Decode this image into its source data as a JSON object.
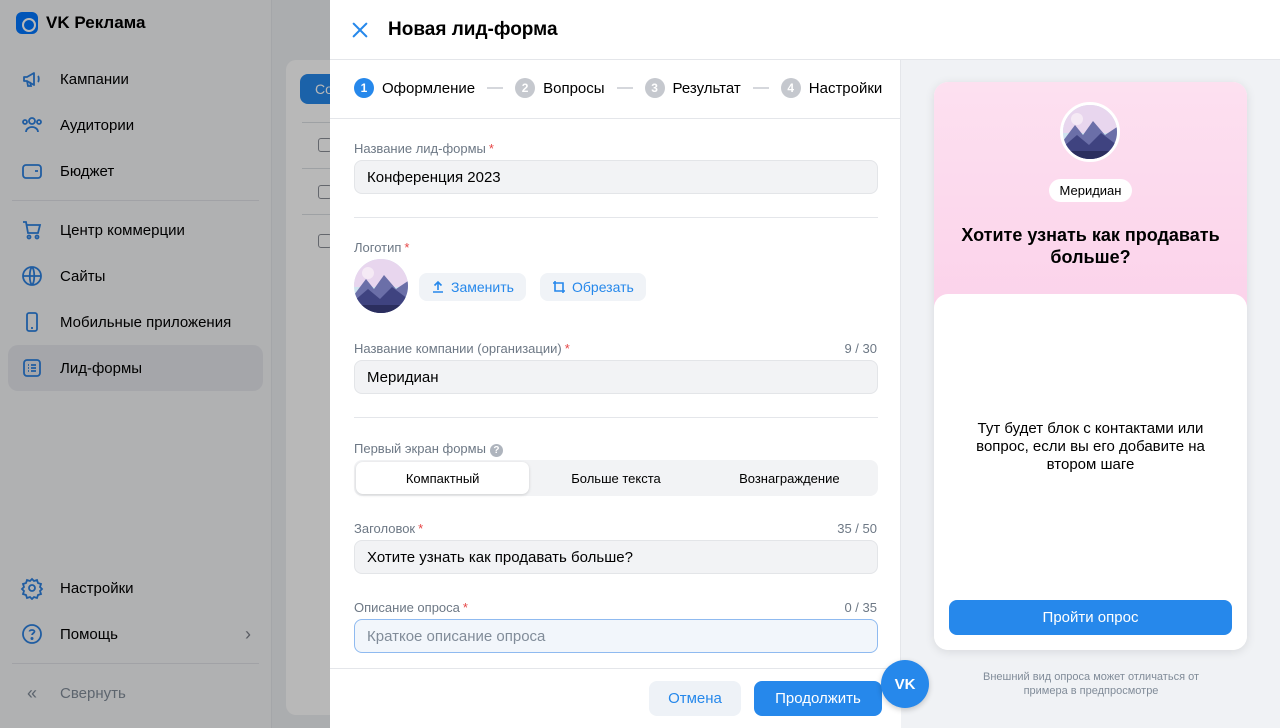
{
  "brand": {
    "name": "VK Реклама"
  },
  "sidebar": {
    "items": [
      {
        "label": "Кампании",
        "icon": "megaphone-icon"
      },
      {
        "label": "Аудитории",
        "icon": "users-icon"
      },
      {
        "label": "Бюджет",
        "icon": "wallet-icon"
      },
      {
        "label": "Центр коммерции",
        "icon": "cart-icon"
      },
      {
        "label": "Сайты",
        "icon": "globe-icon"
      },
      {
        "label": "Мобильные приложения",
        "icon": "phone-icon"
      },
      {
        "label": "Лид-формы",
        "icon": "list-icon",
        "active": true
      }
    ],
    "bottom": [
      {
        "label": "Настройки",
        "icon": "gear-icon"
      },
      {
        "label": "Помощь",
        "icon": "help-icon"
      },
      {
        "label": "Свернуть",
        "icon": "collapse-icon"
      }
    ]
  },
  "background": {
    "button_label": "Со"
  },
  "modal": {
    "title": "Новая лид-форма",
    "steps": [
      {
        "num": "1",
        "label": "Оформление",
        "active": true
      },
      {
        "num": "2",
        "label": "Вопросы"
      },
      {
        "num": "3",
        "label": "Результат"
      },
      {
        "num": "4",
        "label": "Настройки"
      }
    ],
    "form": {
      "name_label": "Название лид-формы",
      "name_value": "Конференция 2023",
      "logo_label": "Логотип",
      "replace_label": "Заменить",
      "crop_label": "Обрезать",
      "company_label": "Название компании (организации)",
      "company_counter": "9 / 30",
      "company_value": "Меридиан",
      "first_screen_label": "Первый экран формы",
      "segments": [
        "Компактный",
        "Больше текста",
        "Вознаграждение"
      ],
      "heading_label": "Заголовок",
      "heading_counter": "35 / 50",
      "heading_value": "Хотите узнать как продавать больше?",
      "desc_label": "Описание опроса",
      "desc_counter": "0 / 35",
      "desc_placeholder": "Краткое описание опроса",
      "required_mark": "*"
    },
    "footer": {
      "cancel_label": "Отмена",
      "continue_label": "Продолжить"
    },
    "preview": {
      "company": "Меридиан",
      "title": "Хотите узнать как продавать больше?",
      "body": "Тут будет блок с контактами или вопрос, если вы его добавите на втором шаге",
      "button": "Пройти опрос",
      "note": "Внешний вид опроса может отличаться от примера в предпросмотре"
    }
  },
  "fab": {
    "label": "VK"
  },
  "colors": {
    "accent": "#2688eb",
    "required": "#e64646",
    "preview_bg": "#fbd2ea"
  }
}
